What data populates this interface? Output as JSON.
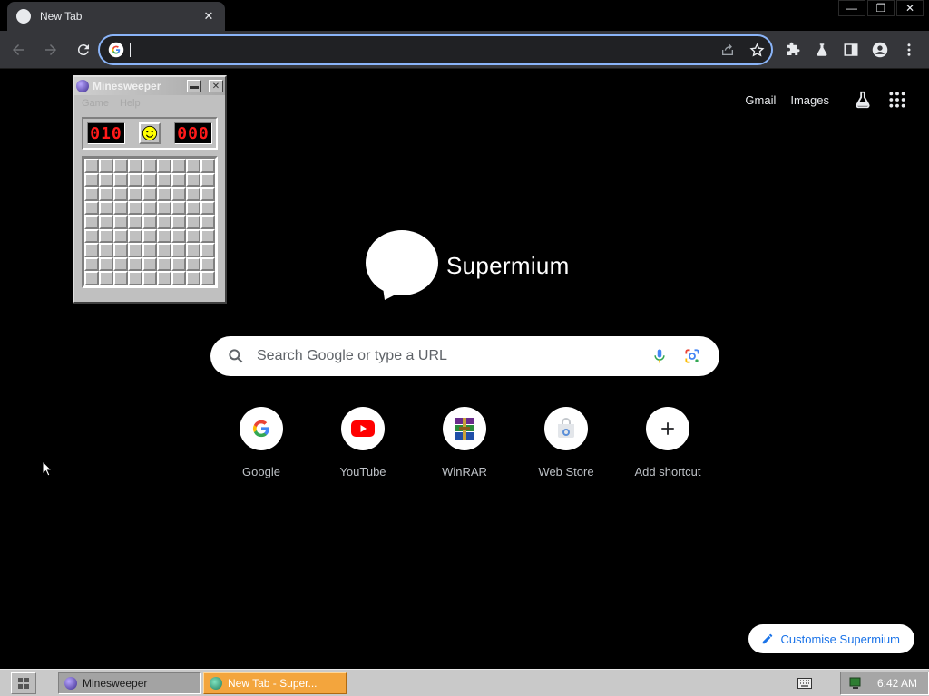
{
  "browser": {
    "tab": {
      "title": "New Tab",
      "close_glyph": "✕"
    },
    "window_controls": {
      "minimize": "—",
      "restore": "❐",
      "close": "✕"
    },
    "omnibox": {
      "value": "",
      "placeholder": ""
    }
  },
  "ntp": {
    "top_links": {
      "gmail": "Gmail",
      "images": "Images"
    },
    "logo_text": "Supermium",
    "search_placeholder": "Search Google or type a URL",
    "shortcuts": [
      {
        "label": "Google",
        "icon": "google-g-icon"
      },
      {
        "label": "YouTube",
        "icon": "youtube-icon"
      },
      {
        "label": "WinRAR",
        "icon": "winrar-icon"
      },
      {
        "label": "Web Store",
        "icon": "web-store-icon"
      },
      {
        "label": "Add shortcut",
        "icon": "plus-icon"
      }
    ],
    "customise_label": "Customise Supermium"
  },
  "minesweeper": {
    "title": "Minesweeper",
    "title_display": "Minesweeper",
    "menu": {
      "game": "Game",
      "help": "Help"
    },
    "mine_counter": "010",
    "timer": "000",
    "rows": 9,
    "cols": 9
  },
  "taskbar": {
    "items": [
      {
        "label": "Minesweeper"
      },
      {
        "label": "New Tab - Super..."
      }
    ],
    "clock": "6:42 AM"
  },
  "colors": {
    "accent": "#8ab4f8",
    "customise_text": "#1a73e8",
    "active_task": "#f3a53d",
    "counter_digits": "#ff1a1a"
  }
}
